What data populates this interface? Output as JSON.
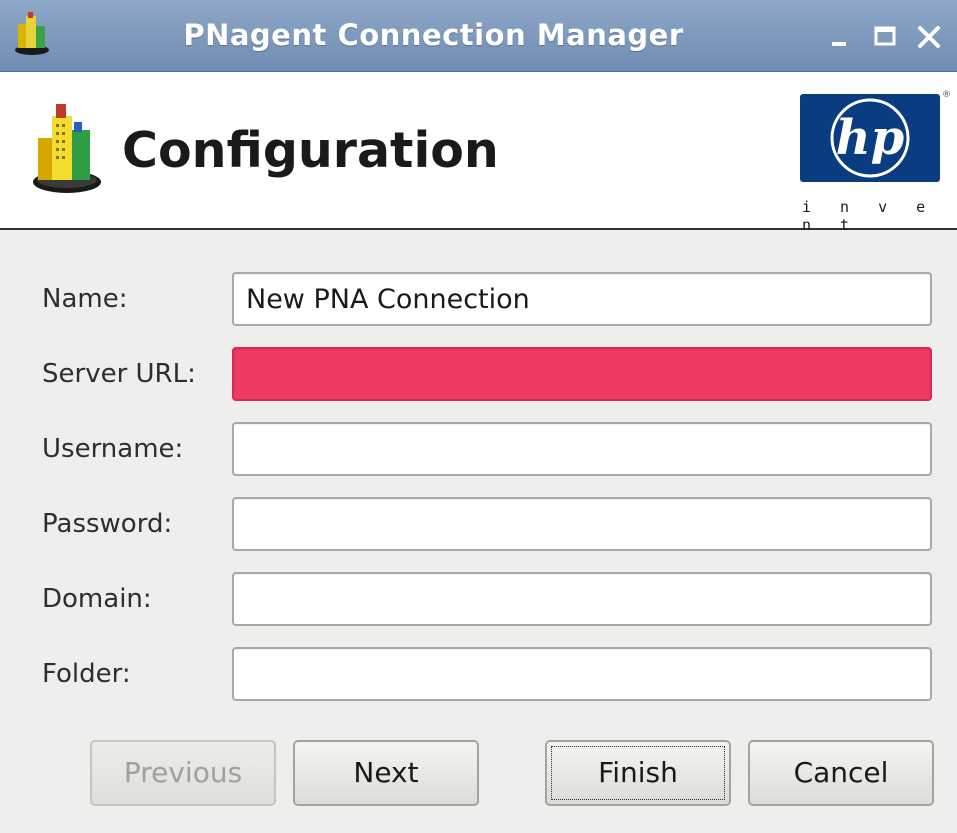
{
  "window": {
    "title": "PNagent Connection Manager",
    "icon": "buildings-icon",
    "controls": {
      "minimize": "minimize-icon",
      "maximize": "maximize-icon",
      "close": "close-icon"
    }
  },
  "header": {
    "title": "Configuration",
    "icon": "buildings-icon",
    "logo": {
      "text": "hp",
      "tagline": "i n v e n t",
      "color": "#0a3c82"
    }
  },
  "form": {
    "fields": [
      {
        "label": "Name:",
        "value": "New PNA Connection",
        "placeholder": ""
      },
      {
        "label": "Server URL:",
        "value": "",
        "placeholder": "",
        "state": "error",
        "error_color": "#ef3a64"
      },
      {
        "label": "Username:",
        "value": "",
        "placeholder": ""
      },
      {
        "label": "Password:",
        "value": "",
        "placeholder": ""
      },
      {
        "label": "Domain:",
        "value": "",
        "placeholder": ""
      },
      {
        "label": "Folder:",
        "value": "",
        "placeholder": ""
      }
    ]
  },
  "buttons": {
    "previous": "Previous",
    "next": "Next",
    "finish": "Finish",
    "cancel": "Cancel"
  }
}
